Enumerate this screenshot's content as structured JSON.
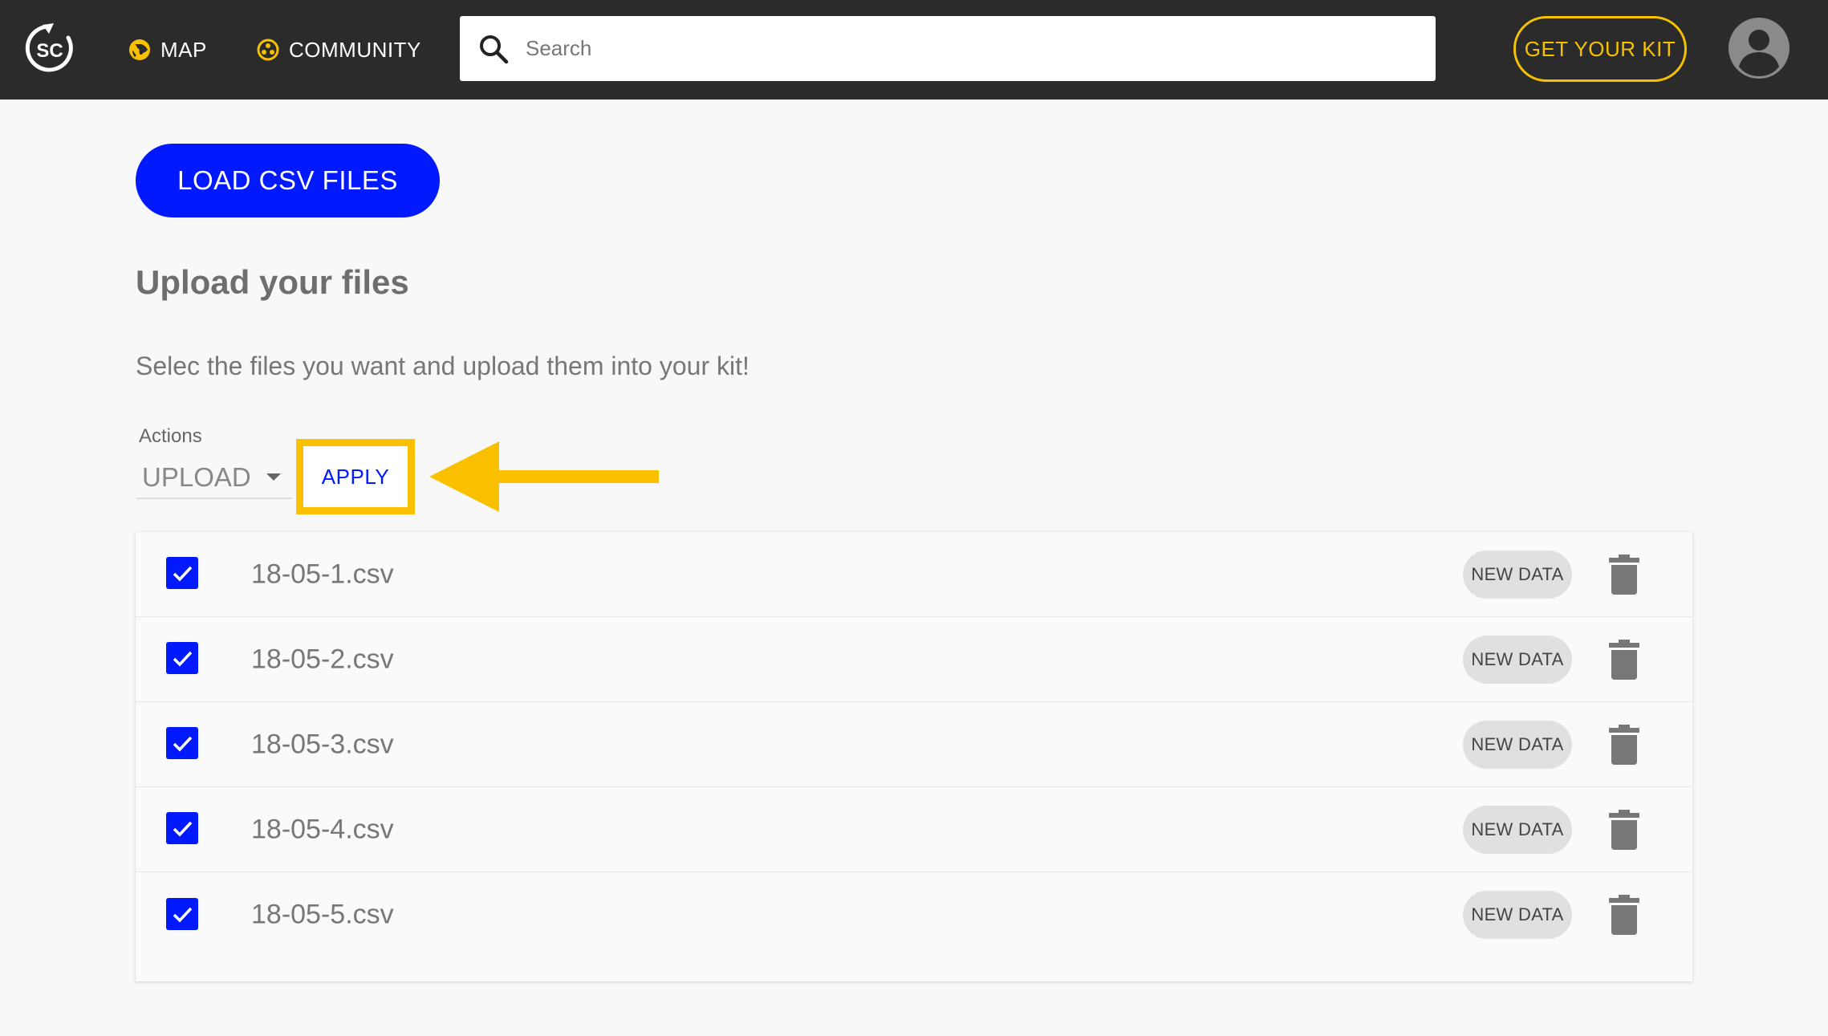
{
  "header": {
    "logo_text": "SC",
    "nav": [
      {
        "label": "MAP",
        "icon": "globe-icon"
      },
      {
        "label": "COMMUNITY",
        "icon": "community-icon"
      }
    ],
    "search_placeholder": "Search",
    "kit_button_label": "GET YOUR KIT",
    "avatar_icon": "user-avatar-icon"
  },
  "main": {
    "load_button_label": "LOAD CSV FILES",
    "title": "Upload your files",
    "subtitle": "Selec the files you want and upload them into your kit!",
    "actions": {
      "label": "Actions",
      "selected": "UPLOAD",
      "apply_label": "APPLY"
    },
    "files": [
      {
        "name": "18-05-1.csv",
        "badge": "NEW DATA",
        "checked": true
      },
      {
        "name": "18-05-2.csv",
        "badge": "NEW DATA",
        "checked": true
      },
      {
        "name": "18-05-3.csv",
        "badge": "NEW DATA",
        "checked": true
      },
      {
        "name": "18-05-4.csv",
        "badge": "NEW DATA",
        "checked": true
      },
      {
        "name": "18-05-5.csv",
        "badge": "NEW DATA",
        "checked": true
      }
    ]
  },
  "colors": {
    "topbar": "#2b2b2b",
    "accent_yellow": "#f7c000",
    "primary_blue": "#0019ff",
    "background": "#f8f8f8"
  }
}
